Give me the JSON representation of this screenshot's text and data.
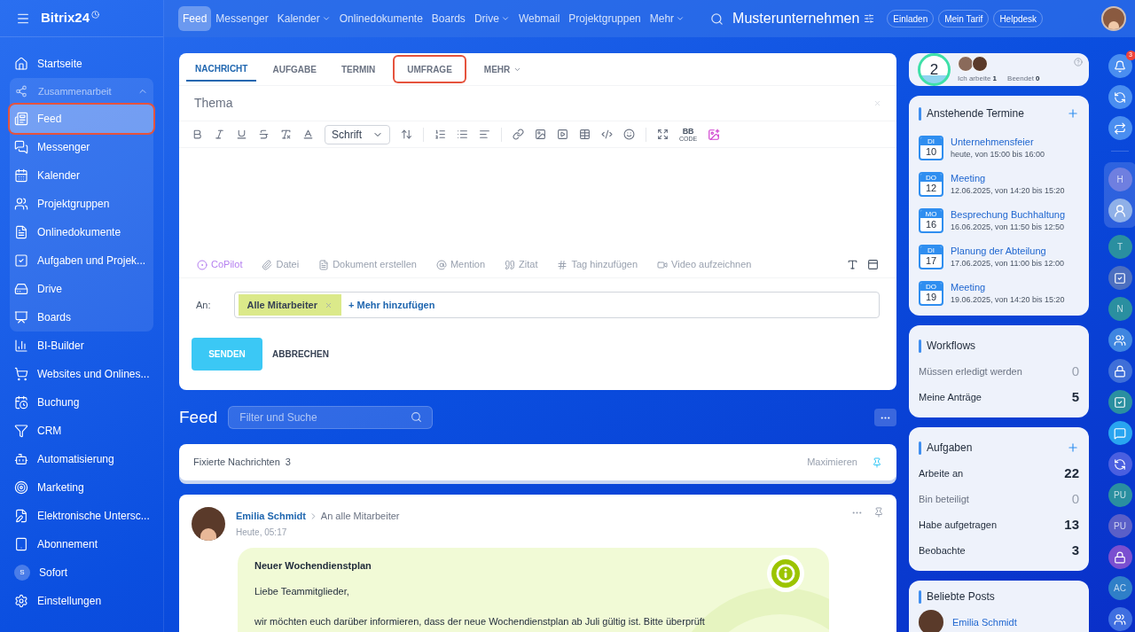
{
  "app": {
    "name": "Bitrix24"
  },
  "top_nav": [
    {
      "label": "Feed",
      "selected": true,
      "dropdown": false
    },
    {
      "label": "Messenger",
      "selected": false,
      "dropdown": false
    },
    {
      "label": "Kalender",
      "selected": false,
      "dropdown": true
    },
    {
      "label": "Onlinedokumente",
      "selected": false,
      "dropdown": false
    },
    {
      "label": "Boards",
      "selected": false,
      "dropdown": false
    },
    {
      "label": "Drive",
      "selected": false,
      "dropdown": true
    },
    {
      "label": "Webmail",
      "selected": false,
      "dropdown": false
    },
    {
      "label": "Projektgruppen",
      "selected": false,
      "dropdown": false
    },
    {
      "label": "Mehr",
      "selected": false,
      "dropdown": true
    }
  ],
  "company": "Musterunternehmen",
  "header_buttons": [
    "Einladen",
    "Mein Tarif",
    "Helpdesk"
  ],
  "sidebar": {
    "items": [
      {
        "kind": "link",
        "label": "Startseite",
        "selected": false,
        "highlighted": false
      },
      {
        "kind": "group",
        "label": "Zusammenarbeit",
        "expanded": true,
        "children": [
          {
            "kind": "link",
            "label": "Feed",
            "selected": true,
            "highlighted": true
          },
          {
            "kind": "link",
            "label": "Messenger",
            "selected": false,
            "highlighted": false
          },
          {
            "kind": "link",
            "label": "Kalender",
            "selected": false,
            "highlighted": false
          },
          {
            "kind": "link",
            "label": "Projektgruppen",
            "selected": false,
            "highlighted": false
          },
          {
            "kind": "link",
            "label": "Onlinedokumente",
            "selected": false,
            "highlighted": false
          },
          {
            "kind": "link",
            "label": "Aufgaben und Projek...",
            "selected": false,
            "highlighted": false
          },
          {
            "kind": "link",
            "label": "Drive",
            "selected": false,
            "highlighted": false
          },
          {
            "kind": "link",
            "label": "Boards",
            "selected": false,
            "highlighted": false
          }
        ]
      },
      {
        "kind": "link",
        "label": "BI-Builder",
        "selected": false,
        "highlighted": false
      },
      {
        "kind": "link",
        "label": "Websites und Onlines...",
        "selected": false,
        "highlighted": false
      },
      {
        "kind": "link",
        "label": "Buchung",
        "selected": false,
        "highlighted": false
      },
      {
        "kind": "link",
        "label": "CRM",
        "selected": false,
        "highlighted": false
      },
      {
        "kind": "link",
        "label": "Automatisierung",
        "selected": false,
        "highlighted": false
      },
      {
        "kind": "link",
        "label": "Marketing",
        "selected": false,
        "highlighted": false
      },
      {
        "kind": "link",
        "label": "Elektronische Untersc...",
        "selected": false,
        "highlighted": false
      },
      {
        "kind": "link",
        "label": "Abonnement",
        "selected": false,
        "highlighted": false
      },
      {
        "kind": "avatar",
        "initial": "S",
        "label": "Sofort",
        "selected": false,
        "highlighted": false
      },
      {
        "kind": "settings",
        "label": "Einstellungen",
        "selected": false,
        "highlighted": false
      }
    ]
  },
  "composer": {
    "tabs": [
      {
        "label": "NACHRICHT",
        "selected": true,
        "highlighted": false,
        "dropdown": false
      },
      {
        "label": "AUFGABE",
        "selected": false,
        "highlighted": false,
        "dropdown": false
      },
      {
        "label": "TERMIN",
        "selected": false,
        "highlighted": false,
        "dropdown": false
      },
      {
        "label": "UMFRAGE",
        "selected": false,
        "highlighted": true,
        "dropdown": false
      },
      {
        "label": "MEHR",
        "selected": false,
        "highlighted": false,
        "dropdown": true
      }
    ],
    "subject_placeholder": "Thema",
    "font_select": "Schrift",
    "bbcode": {
      "label": "BB",
      "sublabel": "CODE"
    },
    "attachments": [
      "CoPilot",
      "Datei",
      "Dokument erstellen",
      "Mention",
      "Zitat",
      "Tag hinzufügen",
      "Video aufzeichnen"
    ],
    "recipients_label": "An:",
    "recipients": [
      "Alle Mitarbeiter"
    ],
    "add_recipients": "+ Mehr hinzufügen",
    "send": "SENDEN",
    "cancel": "ABBRECHEN"
  },
  "feed": {
    "title": "Feed",
    "search_placeholder": "Filter und Suche",
    "pinned": {
      "label": "Fixierte Nachrichten",
      "count": "3",
      "action": "Maximieren"
    },
    "post": {
      "author": "Emilia Schmidt",
      "audience": "An alle Mitarbeiter",
      "time": "Heute, 05:17",
      "title": "Neuer Wochendienstplan",
      "paragraphs": [
        "Liebe Teammitglieder,",
        "wir möchten euch darüber informieren, dass der neue Wochendienstplan ab Juli gültig ist. Bitte überprüft"
      ]
    }
  },
  "work_status": {
    "count": "2",
    "stats": [
      {
        "label": "Ich arbeite",
        "value": "1"
      },
      {
        "label": "Beendet",
        "value": "0"
      }
    ]
  },
  "events": {
    "title": "Anstehende Termine",
    "items": [
      {
        "weekday": "DI",
        "day": "10",
        "title": "Unternehmensfeier",
        "time": "heute, von 15:00 bis 16:00"
      },
      {
        "weekday": "DO",
        "day": "12",
        "title": "Meeting",
        "time": "12.06.2025, von 14:20 bis 15:20"
      },
      {
        "weekday": "MO",
        "day": "16",
        "title": "Besprechung Buchhaltung",
        "time": "16.06.2025, von 11:50 bis 12:50"
      },
      {
        "weekday": "DI",
        "day": "17",
        "title": "Planung der Abteilung",
        "time": "17.06.2025, von 11:00 bis 12:00"
      },
      {
        "weekday": "DO",
        "day": "19",
        "title": "Meeting",
        "time": "19.06.2025, von 14:20 bis 15:20"
      }
    ]
  },
  "workflows": {
    "title": "Workflows",
    "rows": [
      {
        "label": "Müssen erledigt werden",
        "value": "0",
        "muted": true
      },
      {
        "label": "Meine Anträge",
        "value": "5",
        "muted": false
      }
    ]
  },
  "tasks": {
    "title": "Aufgaben",
    "rows": [
      {
        "label": "Arbeite an",
        "value": "22",
        "muted": false
      },
      {
        "label": "Bin beteiligt",
        "value": "0",
        "muted": true
      },
      {
        "label": "Habe aufgetragen",
        "value": "13",
        "muted": false
      },
      {
        "label": "Beobachte",
        "value": "3",
        "muted": false
      }
    ]
  },
  "popular_posts": {
    "title": "Beliebte Posts",
    "items": [
      {
        "author": "Emilia Schmidt"
      }
    ]
  },
  "right_strip": {
    "top": [
      {
        "kind": "icon",
        "badge": "3",
        "color": "#4a8ef0"
      },
      {
        "kind": "icon",
        "color": "#4a8ef0"
      },
      {
        "kind": "icon",
        "color": "#4a8ef0"
      }
    ],
    "group": [
      {
        "kind": "letter",
        "initial": "H",
        "color": "#6f7fe0"
      },
      {
        "kind": "avatar",
        "color": "#8fb0e8"
      }
    ],
    "rest": [
      {
        "kind": "letter",
        "initial": "T",
        "color": "#2a8fa0"
      },
      {
        "kind": "icon",
        "color": "#4c6fc0"
      },
      {
        "kind": "letter",
        "initial": "N",
        "color": "#2a8fa0"
      },
      {
        "kind": "icon",
        "color": "#3f86e0"
      },
      {
        "kind": "icon",
        "color": "#3f6fd8"
      },
      {
        "kind": "icon",
        "color": "#2a8fa0"
      },
      {
        "kind": "icon",
        "color": "#29a5f0"
      },
      {
        "kind": "icon",
        "color": "#4a5fe0"
      },
      {
        "kind": "letter",
        "initial": "PU",
        "color": "#2a8fa0"
      },
      {
        "kind": "letter",
        "initial": "PU",
        "color": "#5a5fc8"
      },
      {
        "kind": "icon",
        "color": "#7a4fd0"
      },
      {
        "kind": "letter",
        "initial": "AC",
        "color": "#2f7fc8"
      },
      {
        "kind": "icon",
        "color": "#3f6fe0"
      }
    ]
  }
}
